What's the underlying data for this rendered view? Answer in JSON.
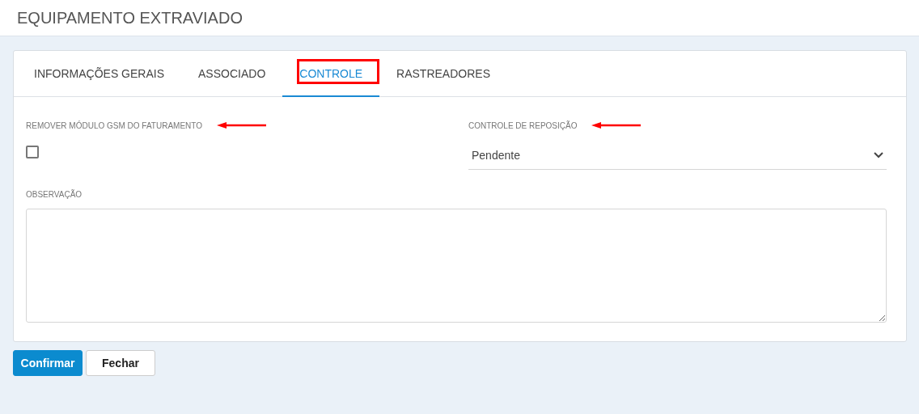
{
  "header": {
    "title": "EQUIPAMENTO EXTRAVIADO"
  },
  "tabs": [
    {
      "label": "INFORMAÇÕES GERAIS",
      "selected": false,
      "highlighted": false
    },
    {
      "label": "ASSOCIADO",
      "selected": false,
      "highlighted": false
    },
    {
      "label": "CONTROLE",
      "selected": true,
      "highlighted": true
    },
    {
      "label": "RASTREADORES",
      "selected": false,
      "highlighted": false
    }
  ],
  "fields": [
    {
      "kind": "checkbox",
      "label": "REMOVER MÓDULO GSM DO FATURAMENTO",
      "checked": false,
      "arrow": true
    },
    {
      "kind": "select",
      "label": "CONTROLE DE REPOSIÇÃO",
      "value": "Pendente",
      "arrow": true
    }
  ],
  "observation": {
    "label": "OBSERVAÇÃO"
  },
  "buttons": [
    {
      "label": "Confirmar",
      "kind": "primary"
    },
    {
      "label": "Fechar",
      "kind": "default"
    }
  ]
}
